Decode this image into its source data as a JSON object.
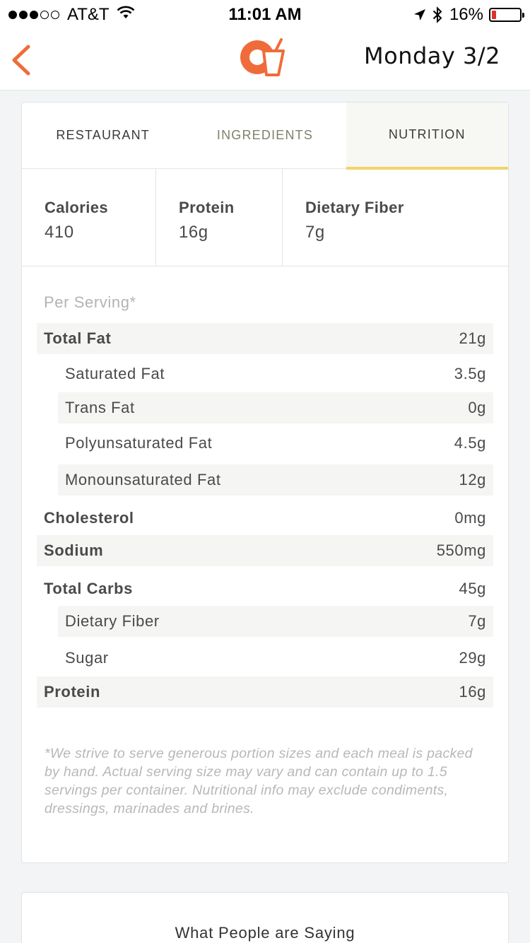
{
  "status_bar": {
    "carrier": "AT&T",
    "time": "11:01 AM",
    "battery_percent": "16%",
    "battery_level": 0.16,
    "signal_bars_filled": 3,
    "signal_bars_total": 5,
    "icons": [
      "wifi-icon",
      "location-arrow-icon",
      "bluetooth-icon",
      "battery-icon"
    ]
  },
  "nav": {
    "date": "Monday 3/2",
    "back_icon": "chevron-left-icon",
    "logo_icon": "plate-and-cup-logo",
    "accent_color": "#ef6c3a"
  },
  "tabs": [
    {
      "label": "RESTAURANT",
      "active": false
    },
    {
      "label": "INGREDIENTS",
      "active": false
    },
    {
      "label": "NUTRITION",
      "active": true
    }
  ],
  "summary": [
    {
      "label": "Calories",
      "value": "410"
    },
    {
      "label": "Protein",
      "value": "16g"
    },
    {
      "label": "Dietary Fiber",
      "value": "7g"
    }
  ],
  "per_serving_label": "Per Serving*",
  "nutrition_rows": [
    {
      "label": "Total Fat",
      "value": "21g"
    },
    {
      "label": "Saturated Fat",
      "value": "3.5g"
    },
    {
      "label": "Trans Fat",
      "value": "0g"
    },
    {
      "label": "Polyunsaturated Fat",
      "value": "4.5g"
    },
    {
      "label": "Monounsaturated Fat",
      "value": "12g"
    },
    {
      "label": "Cholesterol",
      "value": "0mg"
    },
    {
      "label": "Sodium",
      "value": "550mg"
    },
    {
      "label": "Total Carbs",
      "value": "45g"
    },
    {
      "label": "Dietary Fiber",
      "value": "7g"
    },
    {
      "label": "Sugar",
      "value": "29g"
    },
    {
      "label": "Protein",
      "value": "16g"
    }
  ],
  "disclaimer": "*We strive to serve generous portion sizes and each meal is packed by hand. Actual serving size may vary and can contain up to 1.5 servings per container. Nutritional info may exclude condiments, dressings, marinades and brines.",
  "reviews": {
    "title": "What People are Saying"
  },
  "colors": {
    "accent": "#ef6c3a",
    "tab_underline": "#f3d36b",
    "row_shade": "#f5f5f3",
    "battery_low": "#e0302b"
  }
}
